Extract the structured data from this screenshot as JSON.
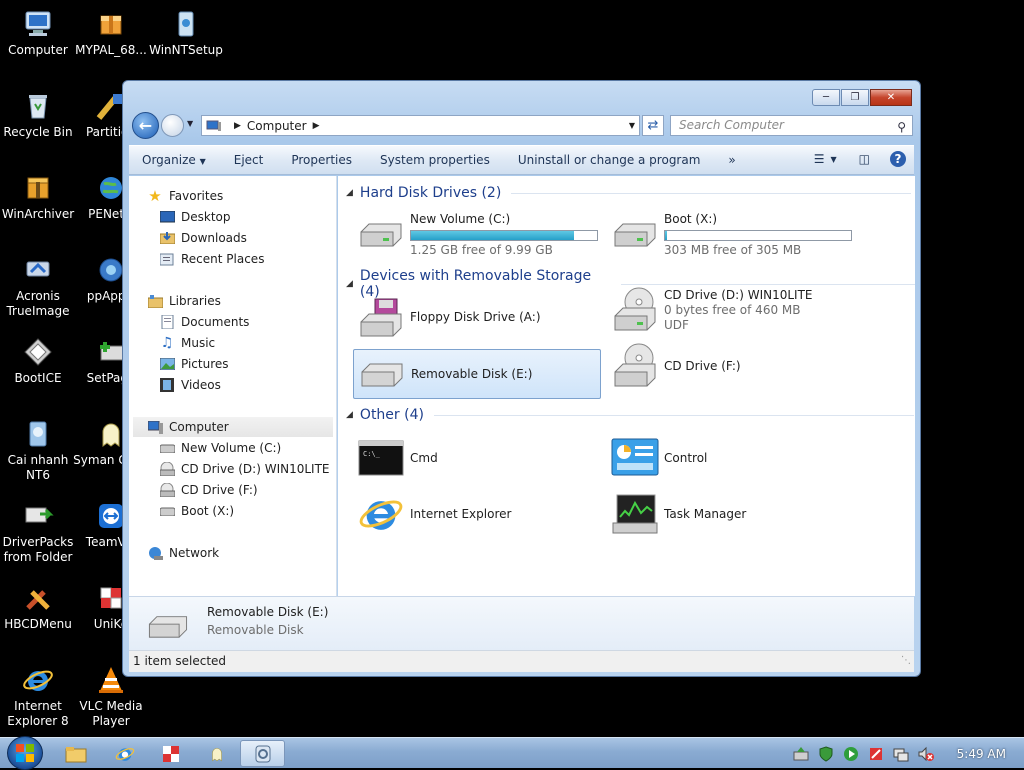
{
  "desktop": {
    "icons": [
      {
        "label": "Computer",
        "icon": "computer-icon"
      },
      {
        "label": "MYPAL_68...",
        "icon": "package-icon"
      },
      {
        "label": "WinNTSetup",
        "icon": "setup-icon"
      },
      {
        "label": "Recycle Bin",
        "icon": "recycle-bin-icon"
      },
      {
        "label": "Partition",
        "icon": "partition-icon"
      },
      {
        "label": "WinArchiver",
        "icon": "archive-icon"
      },
      {
        "label": "PENetw",
        "icon": "network-globe-icon"
      },
      {
        "label": "Acronis TrueImage",
        "icon": "acronis-icon"
      },
      {
        "label": "ppAppsl",
        "icon": "apps-icon"
      },
      {
        "label": "BootICE",
        "icon": "bootice-icon"
      },
      {
        "label": "SetPage",
        "icon": "setpage-icon"
      },
      {
        "label": "Cai nhanh NT6",
        "icon": "install-icon"
      },
      {
        "label": "Syman Ghos",
        "icon": "ghost-icon"
      },
      {
        "label": "DriverPacks from Folder",
        "icon": "driverpacks-icon"
      },
      {
        "label": "TeamVie",
        "icon": "teamviewer-icon"
      },
      {
        "label": "HBCDMenu",
        "icon": "tools-icon"
      },
      {
        "label": "UniKe",
        "icon": "unikey-icon"
      },
      {
        "label": "Internet Explorer 8",
        "icon": "ie-icon"
      },
      {
        "label": "VLC Media Player",
        "icon": "vlc-icon"
      }
    ]
  },
  "window": {
    "address": {
      "location": "Computer"
    },
    "search": {
      "placeholder": "Search Computer"
    },
    "toolbar": {
      "organize": "Organize",
      "eject": "Eject",
      "properties": "Properties",
      "system_properties": "System properties",
      "uninstall": "Uninstall or change a program",
      "more": "»"
    },
    "nav": {
      "favorites": "Favorites",
      "desktop": "Desktop",
      "downloads": "Downloads",
      "recent_places": "Recent Places",
      "libraries": "Libraries",
      "documents": "Documents",
      "music": "Music",
      "pictures": "Pictures",
      "videos": "Videos",
      "computer": "Computer",
      "drive_c": "New Volume (C:)",
      "drive_d": "CD Drive (D:) WIN10LITE",
      "drive_f": "CD Drive (F:)",
      "drive_x": "Boot (X:)",
      "network": "Network"
    },
    "groups": {
      "hard_disks": "Hard Disk Drives (2)",
      "removable": "Devices with Removable Storage (4)",
      "other": "Other (4)"
    },
    "drives": {
      "c": {
        "name": "New Volume (C:)",
        "free": "1.25 GB free of 9.99 GB",
        "used_fraction": 0.875
      },
      "x": {
        "name": "Boot (X:)",
        "free": "303 MB free of 305 MB",
        "used_fraction": 0.007
      },
      "a": {
        "name": "Floppy Disk Drive (A:)"
      },
      "d": {
        "name": "CD Drive (D:) WIN10LITE",
        "free": "0 bytes free of 460 MB",
        "fs": "UDF"
      },
      "e": {
        "name": "Removable Disk (E:)"
      },
      "f": {
        "name": "CD Drive (F:)"
      }
    },
    "other": {
      "cmd": "Cmd",
      "control": "Control",
      "ie": "Internet Explorer",
      "taskmgr": "Task Manager"
    },
    "details": {
      "name": "Removable Disk (E:)",
      "type": "Removable Disk"
    },
    "status": "1 item selected"
  },
  "taskbar": {
    "clock": "5:49 AM"
  },
  "colors": {
    "accent": "#1e3f8c",
    "selection": "#cfe4fa",
    "taskbar": "#8aabd2"
  }
}
